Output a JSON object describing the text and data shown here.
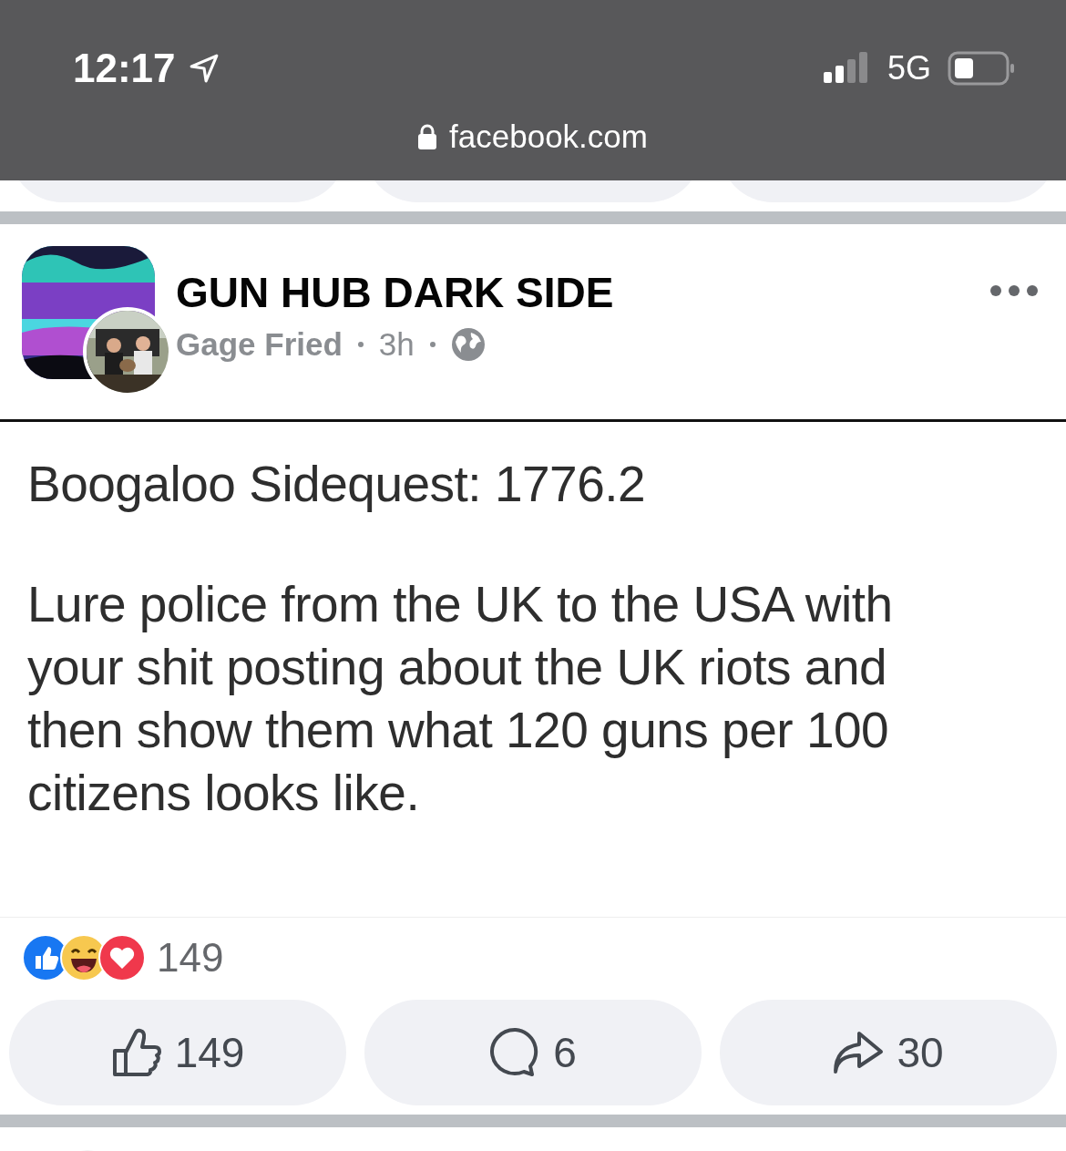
{
  "status_bar": {
    "time": "12:17",
    "network": "5G"
  },
  "browser": {
    "url": "facebook.com"
  },
  "post": {
    "page_name": "GUN HUB DARK SIDE",
    "author": "Gage Fried",
    "time": "3h",
    "meme": {
      "title": "Boogaloo Sidequest: 1776.2",
      "body": "Lure police from the UK to the USA with your shit posting about the UK riots and then show them what 120 guns per 100 citizens looks like."
    },
    "reaction_count": "149",
    "actions": [
      {
        "kind": "like",
        "count": "149"
      },
      {
        "kind": "comment",
        "count": "6"
      },
      {
        "kind": "share",
        "count": "30"
      }
    ]
  }
}
